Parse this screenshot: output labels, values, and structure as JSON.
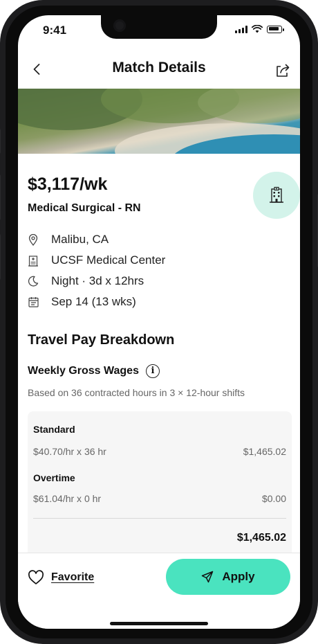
{
  "status_bar": {
    "time": "9:41"
  },
  "nav": {
    "title": "Match Details",
    "back_icon": "chevron-left-icon",
    "share_icon": "share-icon"
  },
  "job": {
    "pay": "$3,117/wk",
    "role": "Medical Surgical  - RN",
    "facility_icon": "hospital-building-icon",
    "details": [
      {
        "icon": "location-pin-icon",
        "text": "Malibu, CA"
      },
      {
        "icon": "hospital-icon",
        "text": "UCSF Medical Center"
      },
      {
        "icon": "moon-icon",
        "text": "Night · 3d x 12hrs"
      },
      {
        "icon": "calendar-icon",
        "text": "Sep 14 (13 wks)"
      }
    ]
  },
  "pay_breakdown": {
    "title": "Travel Pay Breakdown",
    "weekly_title": "Weekly Gross Wages",
    "info_icon": "info-icon",
    "subtitle": "Based on 36 contracted hours in 3 × 12-hour shifts",
    "rows": [
      {
        "label": "Standard",
        "calc": "$40.70/hr x 36 hr",
        "amount": "$1,465.02"
      },
      {
        "label": "Overtime",
        "calc": "$61.04/hr x 0 hr",
        "amount": "$0.00"
      }
    ],
    "total": "$1,465.02"
  },
  "actions": {
    "favorite_label": "Favorite",
    "favorite_icon": "heart-icon",
    "apply_label": "Apply",
    "apply_icon": "send-icon"
  },
  "colors": {
    "accent": "#4ae3bf",
    "badge_bg": "#d3f3ea",
    "muted_text": "#666666"
  }
}
